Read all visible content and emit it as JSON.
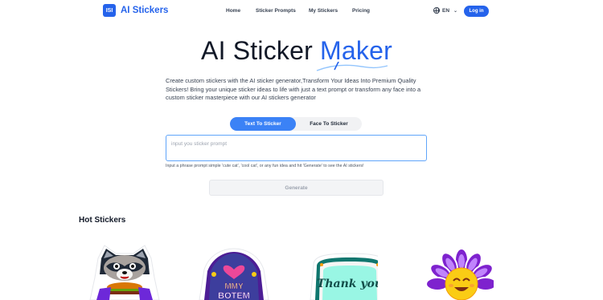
{
  "nav": {
    "logo_mark": "ISI",
    "logo_text": "AI Stickers",
    "links": [
      "Home",
      "Sticker Prompts",
      "My Stickers",
      "Pricing"
    ],
    "language": "EN",
    "login_label": "Log in"
  },
  "hero": {
    "title_main": "AI Sticker ",
    "title_accent": "Maker",
    "description": "Create custom stickers with the AI sticker generator,Transform Your Ideas Into Premium Quality Stickers! Bring your unique sticker ideas to life with just a text prompt or transform any face into a custom sticker masterpiece with our AI stickers generator"
  },
  "tabs": {
    "text_to_sticker": "Text To Sticker",
    "face_to_sticker": "Face To Sticker"
  },
  "prompt": {
    "placeholder": "input you sticker prompt",
    "value": "",
    "hint": "Input a phrase prompt simple 'cute cat', 'cool cat', or any fun idea and hit 'Generate' to see the AI stickers!"
  },
  "generate_label": "Generate",
  "hot_stickers": {
    "title": "Hot Stickers",
    "items": [
      {
        "icon": "raccoon-burger-sticker"
      },
      {
        "icon": "heart-badge-sticker",
        "text_top": "MMY",
        "text_bottom": "BOTEM"
      },
      {
        "icon": "thank-you-badge-sticker",
        "text": "Thank you"
      },
      {
        "icon": "smiling-flower-sticker"
      }
    ]
  },
  "colors": {
    "brand": "#2563eb",
    "tab_active": "#3b82f6"
  }
}
